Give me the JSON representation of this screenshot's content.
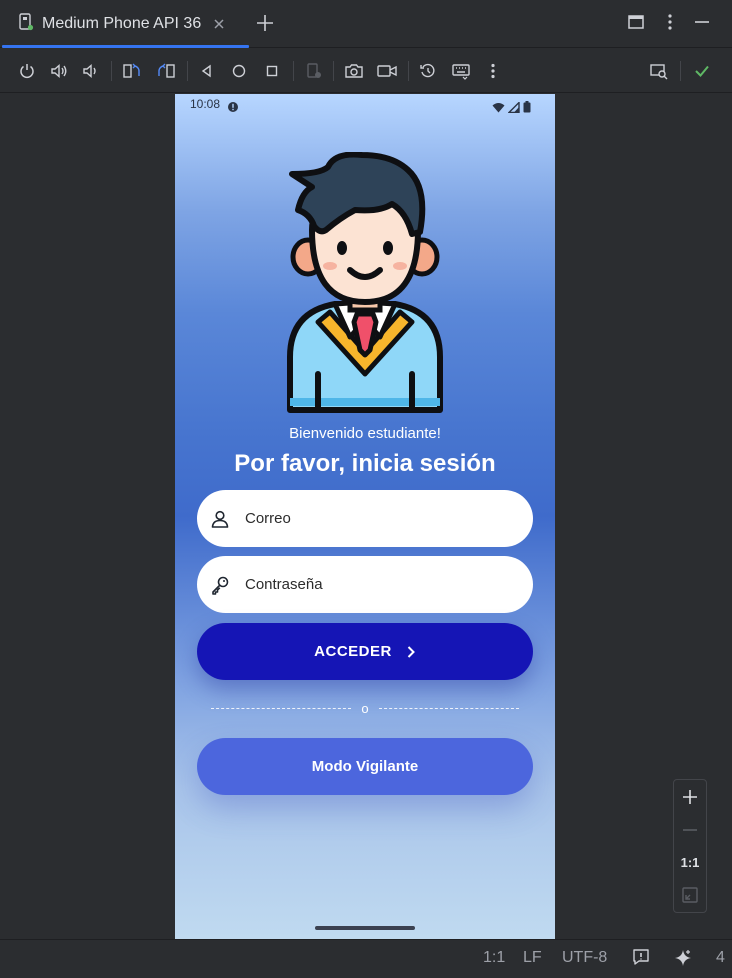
{
  "window": {
    "tab_title": "Medium Phone API 36"
  },
  "phone": {
    "status_time": "10:08",
    "welcome_text": "Bienvenido estudiante!",
    "heading": "Por favor, inicia sesión",
    "email_placeholder": "Correo",
    "password_placeholder": "Contraseña",
    "login_button": "ACCEDER",
    "divider_text": "o",
    "guard_button": "Modo Vigilante"
  },
  "zoom": {
    "actual_size_label": "1:1"
  },
  "status_bar": {
    "position": "1:1",
    "line_separator": "LF",
    "encoding": "UTF-8",
    "indent": "4"
  },
  "colors": {
    "accent": "#3574f0",
    "login_button": "#1515b5",
    "guard_button": "#4c66dd",
    "check": "#5fb865"
  }
}
